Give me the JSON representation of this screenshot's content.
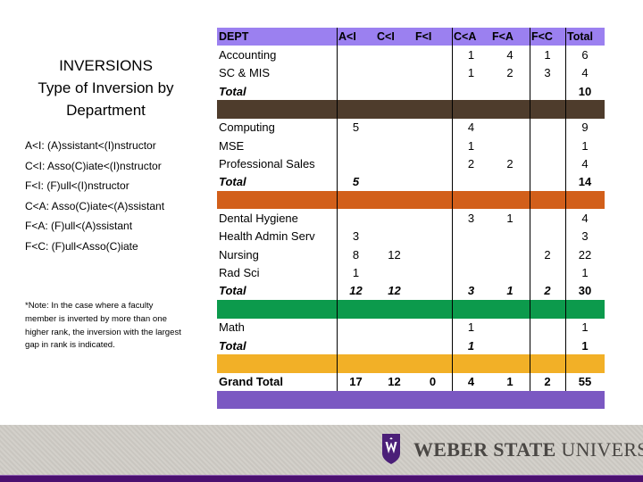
{
  "title": {
    "line1": "INVERSIONS",
    "line2": "Type of Inversion by",
    "line3": "Department"
  },
  "legend": [
    "A<I: (A)ssistant<(I)nstructor",
    "C<I: Asso(C)iate<(I)nstructor",
    "F<I: (F)ull<(I)nstructor",
    "C<A: Asso(C)iate<(A)ssistant",
    "F<A:  (F)ull<(A)ssistant",
    "F<C: (F)ull<Asso(C)iate"
  ],
  "note": "*Note:  In the case where a faculty member is inverted by more than one higher rank, the inversion with the largest gap in rank is indicated.",
  "table": {
    "headers": [
      "DEPT",
      "A<I",
      "C<I",
      "F<I",
      "C<A",
      "F<A",
      "F<C",
      "Total"
    ],
    "groups": [
      {
        "band_color": "#4e3c2c",
        "rows": [
          {
            "dept": "Accounting",
            "values": [
              "",
              "",
              "",
              "1",
              "4",
              "1",
              "6"
            ]
          },
          {
            "dept": "SC & MIS",
            "values": [
              "",
              "",
              "",
              "1",
              "2",
              "3",
              "4"
            ]
          }
        ],
        "total": {
          "label": "Total",
          "values": [
            "",
            "",
            "",
            "",
            "",
            "",
            "10"
          ]
        }
      },
      {
        "band_color": "#d25f1a",
        "rows": [
          {
            "dept": "Computing",
            "values": [
              "5",
              "",
              "",
              "4",
              "",
              "",
              "9"
            ]
          },
          {
            "dept": "MSE",
            "values": [
              "",
              "",
              "",
              "1",
              "",
              "",
              "1"
            ]
          },
          {
            "dept": "Professional Sales",
            "values": [
              "",
              "",
              "",
              "2",
              "2",
              "",
              "4"
            ]
          }
        ],
        "total": {
          "label": "Total",
          "values": [
            "5",
            "",
            "",
            "",
            "",
            "",
            "14"
          ]
        }
      },
      {
        "band_color": "#0c9a4c",
        "rows": [
          {
            "dept": "Dental Hygiene",
            "values": [
              "",
              "",
              "",
              "3",
              "1",
              "",
              "4"
            ]
          },
          {
            "dept": "Health Admin Serv",
            "values": [
              "3",
              "",
              "",
              "",
              "",
              "",
              "3"
            ]
          },
          {
            "dept": "Nursing",
            "values": [
              "8",
              "12",
              "",
              "",
              "",
              "2",
              "22"
            ]
          },
          {
            "dept": "Rad Sci",
            "values": [
              "1",
              "",
              "",
              "",
              "",
              "",
              "1"
            ]
          }
        ],
        "total": {
          "label": "Total",
          "values": [
            "12",
            "12",
            "",
            "3",
            "1",
            "2",
            "30"
          ]
        }
      },
      {
        "band_color": "#f2b027",
        "rows": [
          {
            "dept": "Math",
            "values": [
              "",
              "",
              "",
              "1",
              "",
              "",
              "1"
            ]
          }
        ],
        "total": {
          "label": "Total",
          "values": [
            "",
            "",
            "",
            "1",
            "",
            "",
            "1"
          ]
        }
      }
    ],
    "grand_total": {
      "label": "Grand Total",
      "values": [
        "17",
        "12",
        "0",
        "4",
        "1",
        "2",
        "55"
      ]
    },
    "colors": {
      "header": "#9b80f0",
      "bottom_band": "#7b58c2"
    }
  },
  "footer": {
    "logo_bold": "WEBER STATE",
    "logo_light": "UNIVERSITY",
    "brand_color": "#4b1070"
  }
}
